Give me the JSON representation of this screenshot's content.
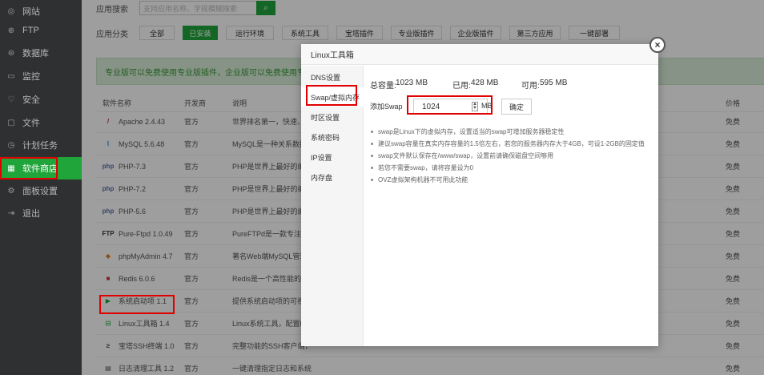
{
  "sidebar": {
    "items": [
      {
        "label": "网站",
        "icon": "globe-icon",
        "glyph": "◎"
      },
      {
        "label": "FTP",
        "icon": "ftp-icon",
        "glyph": "⊕"
      },
      {
        "label": "数据库",
        "icon": "database-icon",
        "glyph": "⊜"
      },
      {
        "label": "监控",
        "icon": "monitor-icon",
        "glyph": "▭"
      },
      {
        "label": "安全",
        "icon": "shield-icon",
        "glyph": "♡"
      },
      {
        "label": "文件",
        "icon": "folder-icon",
        "glyph": "▢"
      },
      {
        "label": "计划任务",
        "icon": "clock-icon",
        "glyph": "◷"
      },
      {
        "label": "软件商店",
        "icon": "grid-icon",
        "glyph": "▦"
      },
      {
        "label": "面板设置",
        "icon": "settings-icon",
        "glyph": "⚙"
      },
      {
        "label": "退出",
        "icon": "logout-icon",
        "glyph": "⇥"
      }
    ]
  },
  "search": {
    "label": "应用搜索",
    "placeholder": "支持应用名称、字段模糊搜索",
    "button_icon": "search-icon"
  },
  "categories": {
    "label": "应用分类",
    "items": [
      "全部",
      "已安装",
      "运行环境",
      "系统工具",
      "宝塔插件",
      "专业版插件",
      "企业版插件",
      "第三方应用",
      "一键部署"
    ],
    "selected": "已安装"
  },
  "promo": {
    "text": "专业版可以免费使用专业版插件，企业版可以免费使用专业版及企业"
  },
  "table": {
    "headers": {
      "name": "软件名称",
      "dev": "开发商",
      "desc": "说明",
      "price": "价格"
    },
    "rows": [
      {
        "name": "Apache 2.4.43",
        "dev": "官方",
        "desc": "世界排名第一，快速、可",
        "price": "免费",
        "icon": "apache-icon",
        "glyph": "/",
        "color": "#c0392b"
      },
      {
        "name": "MySQL 5.6.48",
        "dev": "官方",
        "desc": "MySQL是一种关系数据库",
        "price": "免费",
        "icon": "mysql-icon",
        "glyph": "⌇",
        "color": "#2c7fb8"
      },
      {
        "name": "PHP-7.3",
        "dev": "官方",
        "desc": "PHP是世界上最好的编程",
        "price": "免费",
        "icon": "php-icon",
        "glyph": "php",
        "color": "#5b6fa6"
      },
      {
        "name": "PHP-7.2",
        "dev": "官方",
        "desc": "PHP是世界上最好的编程",
        "price": "免费",
        "icon": "php-icon",
        "glyph": "php",
        "color": "#5b6fa6"
      },
      {
        "name": "PHP-5.6",
        "dev": "官方",
        "desc": "PHP是世界上最好的编程",
        "price": "免费",
        "icon": "php-icon",
        "glyph": "php",
        "color": "#5b6fa6"
      },
      {
        "name": "Pure-Ftpd 1.0.49",
        "dev": "官方",
        "desc": "PureFTPd是一款专注于程",
        "price": "免费",
        "icon": "ftpd-icon",
        "glyph": "FTP",
        "color": "#333333"
      },
      {
        "name": "phpMyAdmin 4.7",
        "dev": "官方",
        "desc": "著名Web端MySQL管理工",
        "price": "免费",
        "icon": "phpmyadmin-icon",
        "glyph": "◆",
        "color": "#e67e22"
      },
      {
        "name": "Redis 6.0.6",
        "dev": "官方",
        "desc": "Redis是一个高性能的key",
        "price": "免费",
        "icon": "redis-icon",
        "glyph": "■",
        "color": "#c0392b"
      },
      {
        "name": "系统启动项 1.1",
        "dev": "官方",
        "desc": "提供系统启动项的可视化",
        "price": "免费",
        "icon": "startup-icon",
        "glyph": "▶",
        "color": "#20a53a"
      },
      {
        "name": "Linux工具箱 1.4",
        "dev": "官方",
        "desc": "Linux系统工具，配置DN",
        "price": "免费",
        "icon": "toolbox-icon",
        "glyph": "⊟",
        "color": "#20a53a"
      },
      {
        "name": "宝塔SSH终端 1.0",
        "dev": "官方",
        "desc": "完整功能的SSH客户端，",
        "price": "免费",
        "icon": "terminal-icon",
        "glyph": "≥",
        "color": "#555555"
      },
      {
        "name": "日志清理工具 1.2",
        "dev": "官方",
        "desc": "一键清理指定日志和系统",
        "price": "免费",
        "icon": "log-icon",
        "glyph": "▤",
        "color": "#555555"
      }
    ]
  },
  "dialog": {
    "title": "Linux工具箱",
    "close_icon": "close-icon",
    "nav": [
      "DNS设置",
      "Swap/虚拟内存",
      "时区设置",
      "系统密码",
      "IP设置",
      "内存盘"
    ],
    "nav_selected": "Swap/虚拟内存",
    "stats": {
      "total_label": "总容量:",
      "total_value": "1023 MB",
      "used_label": "已用:",
      "used_value": "428 MB",
      "free_label": "可用:",
      "free_value": "595 MB"
    },
    "swap": {
      "label": "添加Swap",
      "value": "1024",
      "unit": "MB",
      "confirm": "确定"
    },
    "tips": [
      "swap是Linux下的虚拟内存，设置适当的swap可增加服务器稳定性",
      "建议swap容量在真实内存容量的1.5倍左右，若您的服务器内存大于4GB，可设1-2GB的固定值",
      "swap文件默认保存在/www/swap，设置前请确保磁盘空间够用",
      "若您不需要swap，请将容量设为0",
      "OVZ虚拟架构机器不可用此功能"
    ]
  }
}
